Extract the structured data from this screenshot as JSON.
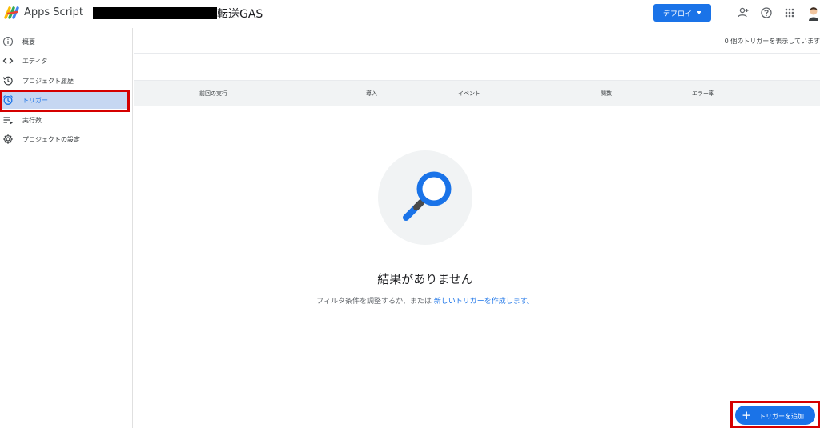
{
  "header": {
    "app_name": "Apps Script",
    "project_name": "転送GAS",
    "deploy_label": "デプロイ",
    "icons": [
      "add-person-icon",
      "help-icon",
      "apps-grid-icon",
      "avatar"
    ]
  },
  "sidebar": {
    "items": [
      {
        "label": "概要",
        "icon": "info-icon"
      },
      {
        "label": "エディタ",
        "icon": "code-icon"
      },
      {
        "label": "プロジェクト履歴",
        "icon": "history-icon"
      },
      {
        "label": "トリガー",
        "icon": "alarm-icon",
        "active": true
      },
      {
        "label": "実行数",
        "icon": "executions-icon"
      },
      {
        "label": "プロジェクトの設定",
        "icon": "gear-icon"
      }
    ]
  },
  "main": {
    "showing_text": "0 個のトリガーを表示しています",
    "columns": [
      "前回の実行",
      "導入",
      "イベント",
      "関数",
      "エラー率"
    ],
    "empty_title": "結果がありません",
    "empty_desc_prefix": "フィルタ条件を調整するか、または ",
    "empty_desc_link": "新しいトリガーを作成します",
    "empty_desc_suffix": "。",
    "add_trigger_label": "トリガーを追加"
  },
  "colors": {
    "accent": "#1a73e8",
    "highlight": "#d50000",
    "active_bg": "#c6d7f2"
  }
}
